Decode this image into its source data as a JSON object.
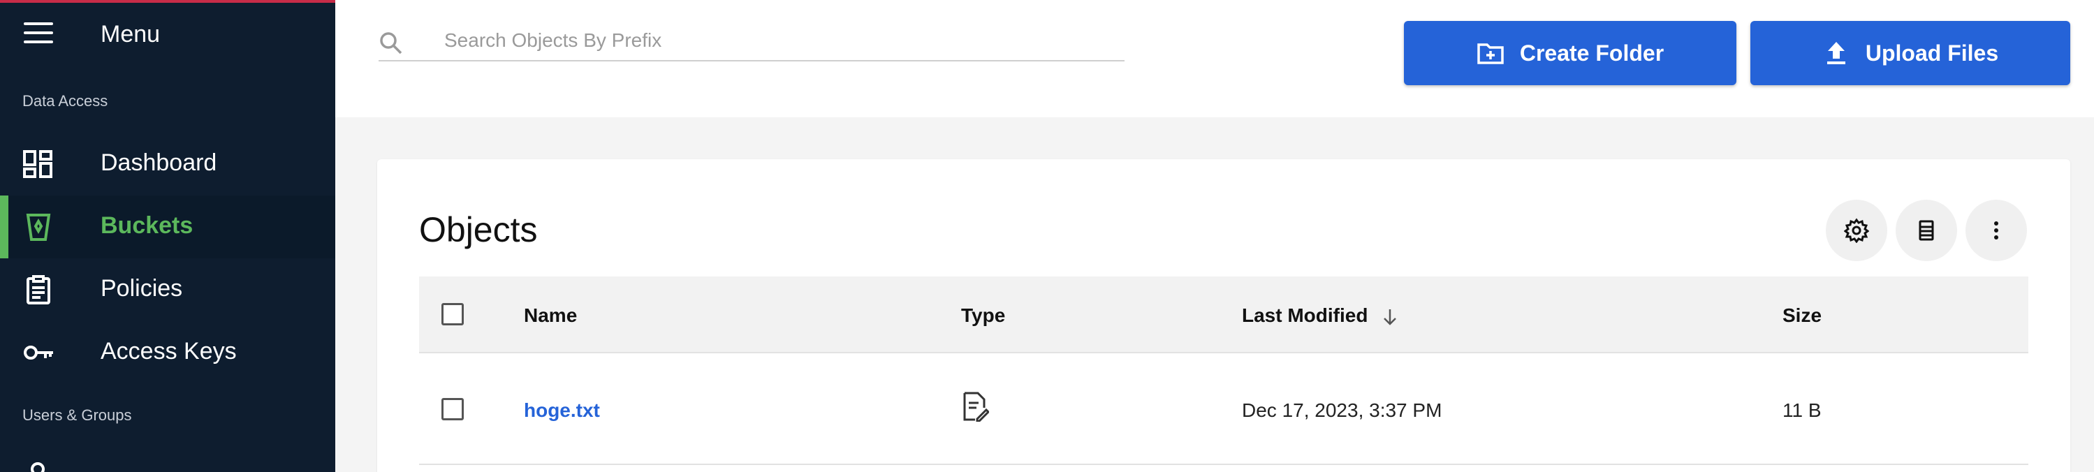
{
  "sidebar": {
    "menu_label": "Menu",
    "sections": [
      {
        "label": "Data Access"
      },
      {
        "label": "Users & Groups"
      }
    ],
    "items": [
      {
        "label": "Dashboard",
        "icon": "dashboard-icon",
        "active": false
      },
      {
        "label": "Buckets",
        "icon": "bucket-icon",
        "active": true
      },
      {
        "label": "Policies",
        "icon": "clipboard-icon",
        "active": false
      },
      {
        "label": "Access Keys",
        "icon": "key-icon",
        "active": false
      }
    ],
    "accent_color": "#5cb85c",
    "background_color": "#0e1d2f"
  },
  "search": {
    "placeholder": "Search Objects By Prefix",
    "value": ""
  },
  "toolbar": {
    "create_folder_label": "Create Folder",
    "upload_files_label": "Upload Files",
    "button_color": "#2563d8"
  },
  "objects": {
    "title": "Objects",
    "columns": [
      "Name",
      "Type",
      "Last Modified",
      "Size"
    ],
    "sort_column": "Last Modified",
    "sort_direction": "descending",
    "rows": [
      {
        "name": "hoge.txt",
        "type_icon": "text-file-icon",
        "last_modified": "Dec 17, 2023, 3:37 PM",
        "size": "11 B"
      }
    ]
  }
}
